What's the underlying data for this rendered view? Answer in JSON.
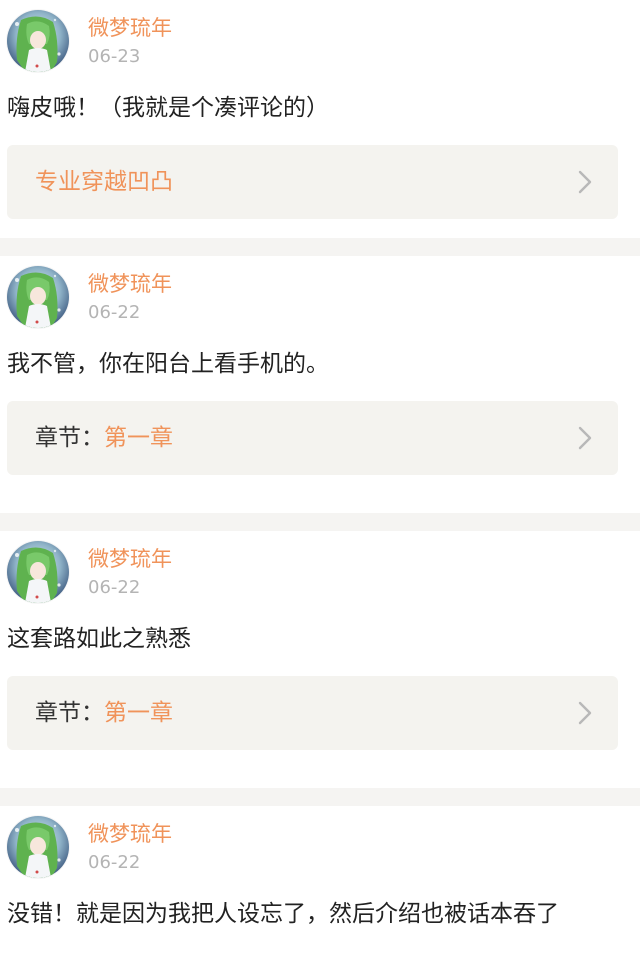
{
  "theme": {
    "accent": "#f0935a",
    "text": "#222222",
    "muted": "#b4b4b4",
    "card_bg": "#f4f3ef",
    "divider_bg": "#f5f4f2"
  },
  "comments": [
    {
      "username": "微梦琉年",
      "date": "06-23",
      "text": "嗨皮哦！（我就是个凑评论的）",
      "ref_prefix": "",
      "ref_title": "专业穿越凹凸",
      "icon": "chevron-right-icon"
    },
    {
      "username": "微梦琉年",
      "date": "06-22",
      "text": "我不管，你在阳台上看手机的。",
      "ref_prefix": "章节：",
      "ref_title": "第一章",
      "icon": "chevron-right-icon"
    },
    {
      "username": "微梦琉年",
      "date": "06-22",
      "text": "这套路如此之熟悉",
      "ref_prefix": "章节：",
      "ref_title": "第一章",
      "icon": "chevron-right-icon"
    },
    {
      "username": "微梦琉年",
      "date": "06-22",
      "text": "没错！就是因为我把人设忘了，然后介绍也被话本吞了",
      "ref_prefix": "",
      "ref_title": "",
      "icon": ""
    }
  ]
}
